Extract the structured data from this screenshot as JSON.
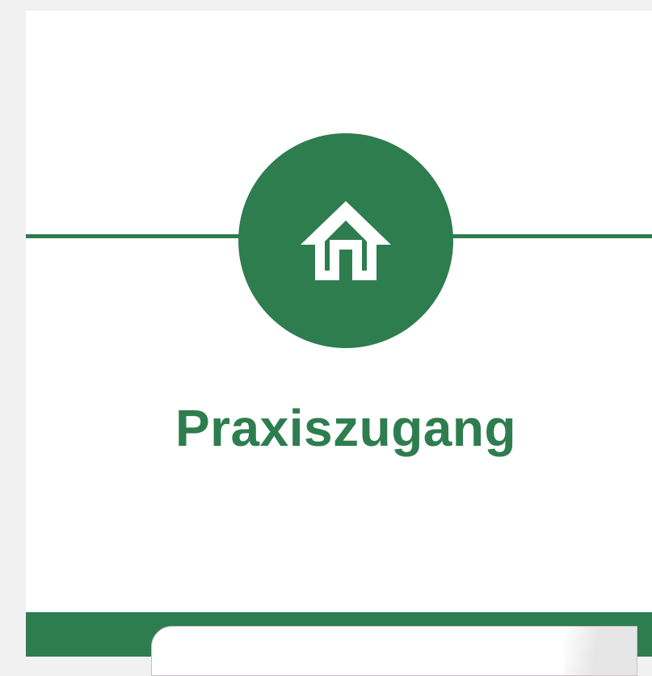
{
  "step": {
    "title": "Praxiszugang",
    "icon": "home-icon"
  },
  "colors": {
    "accent": "#2e7d4f",
    "background": "#f1f1f1",
    "card": "#ffffff"
  }
}
